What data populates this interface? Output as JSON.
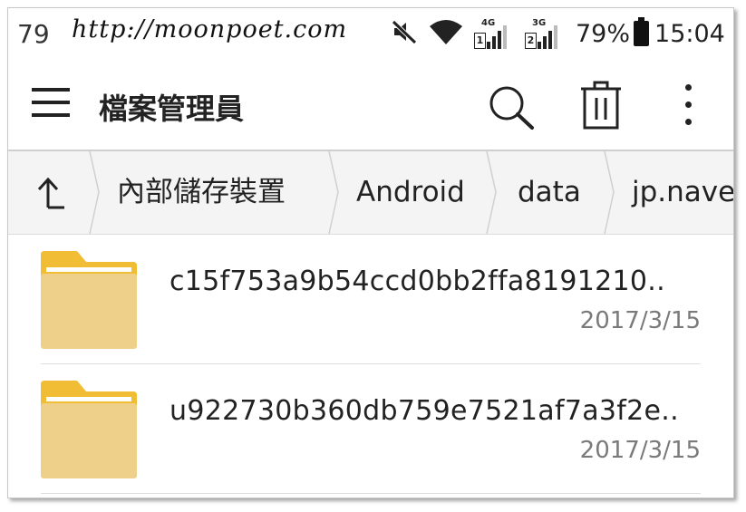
{
  "status_bar": {
    "left_number": "79",
    "watermark_url": "http://moonpoet.com",
    "sim1_label": "4G",
    "sim1_number": "1",
    "sim2_label": "3G",
    "sim2_number": "2",
    "battery_percent": "79%",
    "time": "15:04",
    "icons": [
      "mute-icon",
      "wifi-icon",
      "signal-sim1-icon",
      "signal-sim2-icon",
      "battery-icon"
    ]
  },
  "toolbar": {
    "title": "檔案管理員",
    "actions": [
      "menu-icon",
      "search-icon",
      "delete-icon",
      "more-vertical-icon"
    ]
  },
  "breadcrumb": {
    "items": [
      "內部儲存裝置",
      "Android",
      "data",
      "jp.nave"
    ]
  },
  "files": [
    {
      "name": "c15f753a9b54ccd0bb2ffa8191210..",
      "date": "2017/3/15",
      "icon": "folder-icon"
    },
    {
      "name": "u922730b360db759e7521af7a3f2e..",
      "date": "2017/3/15",
      "icon": "folder-icon"
    }
  ],
  "colors": {
    "folder_back": "#F0BD34",
    "folder_front": "#EED08A",
    "date_text": "#7A7A7A",
    "breadcrumb_bg": "#F4F4F4"
  }
}
